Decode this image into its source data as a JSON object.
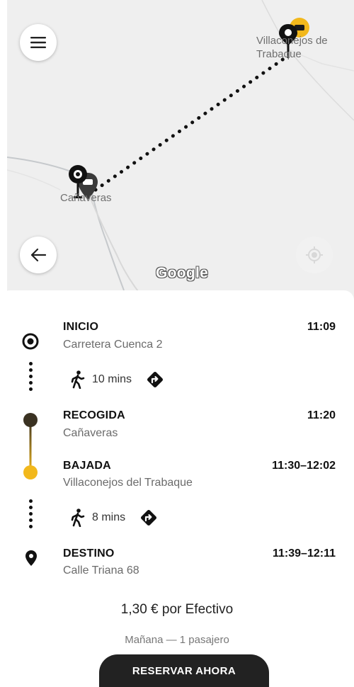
{
  "map": {
    "town_origin": "Cañaveras",
    "town_destination": "Villaconejos de Trabaque",
    "brand": "Google",
    "icons": {
      "menu": "hamburger-menu-icon",
      "back": "arrow-left-icon",
      "locate": "crosshair-location-icon"
    }
  },
  "trip": {
    "stops": [
      {
        "title": "INICIO",
        "subtitle": "Carretera Cuenca 2",
        "time": "11:09"
      },
      {
        "title": "RECOGIDA",
        "subtitle": "Cañaveras",
        "time": "11:20"
      },
      {
        "title": "BAJADA",
        "subtitle": "Villaconejos del Trabaque",
        "time": "11:30–12:02"
      },
      {
        "title": "DESTINO",
        "subtitle": "Calle Triana 68",
        "time": "11:39–12:11"
      }
    ],
    "walks": [
      {
        "duration": "10 mins"
      },
      {
        "duration": "8 mins"
      }
    ],
    "accent_color": "#f2b81c",
    "dark_color": "#3a3222"
  },
  "summary": {
    "price": "1,30 € por Efectivo",
    "when": "Mañana — 1 pasajero",
    "cta": "RESERVAR AHORA"
  }
}
